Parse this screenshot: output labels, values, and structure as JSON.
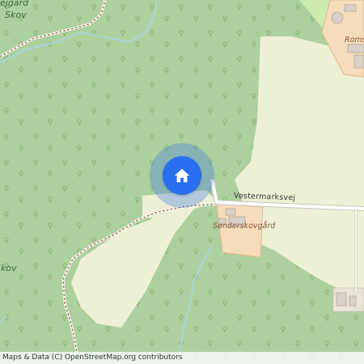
{
  "map": {
    "labels": {
      "forest_top": "ejgård",
      "forest_top2": "Skov",
      "forest_left": "Skov",
      "farm_1": "Sønderskovgård",
      "farm_2": "Roms",
      "road": "Vestermarksvej"
    },
    "marker": {
      "icon": "home-icon",
      "color": "#2a6ff0"
    },
    "colors": {
      "forest": "#add19e",
      "farmland": "#eef0d5",
      "farmyard": "#f5dcba",
      "building": "#d9d0c9",
      "water": "#aad3df",
      "road": "#ffffff",
      "track": "#a0744a"
    }
  },
  "attribution": "Maps & Data (C) OpenStreetMap.org contributors"
}
